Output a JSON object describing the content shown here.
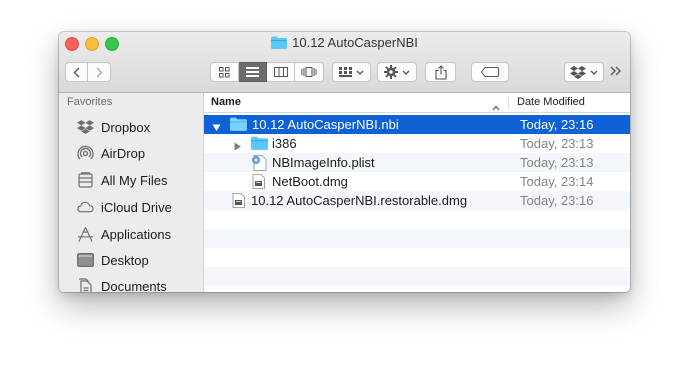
{
  "window": {
    "title": "10.12 AutoCasperNBI"
  },
  "toolbar": {
    "back_label": "back",
    "forward_label": "forward",
    "views": [
      "icon",
      "list",
      "column",
      "cover-flow"
    ],
    "active_view": "list"
  },
  "sidebar": {
    "section_title": "Favorites",
    "items": [
      {
        "label": "Dropbox",
        "icon": "dropbox-icon"
      },
      {
        "label": "AirDrop",
        "icon": "airdrop-icon"
      },
      {
        "label": "All My Files",
        "icon": "all-my-files-icon"
      },
      {
        "label": "iCloud Drive",
        "icon": "icloud-icon"
      },
      {
        "label": "Applications",
        "icon": "applications-icon"
      },
      {
        "label": "Desktop",
        "icon": "desktop-icon"
      },
      {
        "label": "Documents",
        "icon": "documents-icon"
      }
    ]
  },
  "columns": {
    "name": "Name",
    "date": "Date Modified"
  },
  "rows": [
    {
      "name": "10.12 AutoCasperNBI.nbi",
      "date": "Today, 23:16",
      "icon": "folder-icon",
      "expanded": true,
      "selected": true
    },
    {
      "name": "i386",
      "date": "Today, 23:13",
      "icon": "folder-icon",
      "expanded": false
    },
    {
      "name": "NBImageInfo.plist",
      "date": "Today, 23:13",
      "icon": "plist-icon"
    },
    {
      "name": "NetBoot.dmg",
      "date": "Today, 23:14",
      "icon": "dmg-icon"
    },
    {
      "name": "10.12 AutoCasperNBI.restorable.dmg",
      "date": "Today, 23:16",
      "icon": "dmg-icon"
    }
  ],
  "colors": {
    "selection": "#0f62d6",
    "folder": "#5ac8fa"
  }
}
